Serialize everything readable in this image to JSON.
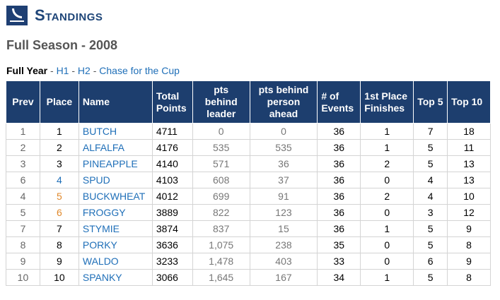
{
  "header": {
    "title": "Standings",
    "logo_icon": "speedway-logo-icon"
  },
  "subtitle": "Full Season - 2008",
  "nav": {
    "current": "Full Year",
    "separator": " - ",
    "links": [
      "H1",
      "H2",
      "Chase for the Cup"
    ]
  },
  "colors": {
    "header_bg": "#1d3e6e",
    "link": "#1f6fb8",
    "place_up": "#1f6fb8",
    "place_down": "#e0892c"
  },
  "table": {
    "columns": [
      "Prev",
      "Place",
      "Name",
      "Total Points",
      "pts behind leader",
      "pts behind person ahead",
      "# of Events",
      "1st Place Finishes",
      "Top 5",
      "Top 10"
    ],
    "rows": [
      {
        "prev": "1",
        "place": "1",
        "name": "BUTCH",
        "total": "4711",
        "behind_leader": "0",
        "behind_ahead": "0",
        "events": "36",
        "wins": "1",
        "top5": "7",
        "top10": "18"
      },
      {
        "prev": "2",
        "place": "2",
        "name": "ALFALFA",
        "total": "4176",
        "behind_leader": "535",
        "behind_ahead": "535",
        "events": "36",
        "wins": "1",
        "top5": "5",
        "top10": "11"
      },
      {
        "prev": "3",
        "place": "3",
        "name": "PINEAPPLE",
        "total": "4140",
        "behind_leader": "571",
        "behind_ahead": "36",
        "events": "36",
        "wins": "2",
        "top5": "5",
        "top10": "13"
      },
      {
        "prev": "6",
        "place": "4",
        "name": "SPUD",
        "total": "4103",
        "behind_leader": "608",
        "behind_ahead": "37",
        "events": "36",
        "wins": "0",
        "top5": "4",
        "top10": "13"
      },
      {
        "prev": "4",
        "place": "5",
        "name": "BUCKWHEAT",
        "total": "4012",
        "behind_leader": "699",
        "behind_ahead": "91",
        "events": "36",
        "wins": "2",
        "top5": "4",
        "top10": "10"
      },
      {
        "prev": "5",
        "place": "6",
        "name": "FROGGY",
        "total": "3889",
        "behind_leader": "822",
        "behind_ahead": "123",
        "events": "36",
        "wins": "0",
        "top5": "3",
        "top10": "12"
      },
      {
        "prev": "7",
        "place": "7",
        "name": "STYMIE",
        "total": "3874",
        "behind_leader": "837",
        "behind_ahead": "15",
        "events": "36",
        "wins": "1",
        "top5": "5",
        "top10": "9"
      },
      {
        "prev": "8",
        "place": "8",
        "name": "PORKY",
        "total": "3636",
        "behind_leader": "1,075",
        "behind_ahead": "238",
        "events": "35",
        "wins": "0",
        "top5": "5",
        "top10": "8"
      },
      {
        "prev": "9",
        "place": "9",
        "name": "WALDO",
        "total": "3233",
        "behind_leader": "1,478",
        "behind_ahead": "403",
        "events": "33",
        "wins": "0",
        "top5": "6",
        "top10": "9"
      },
      {
        "prev": "10",
        "place": "10",
        "name": "SPANKY",
        "total": "3066",
        "behind_leader": "1,645",
        "behind_ahead": "167",
        "events": "34",
        "wins": "1",
        "top5": "5",
        "top10": "8"
      }
    ]
  }
}
